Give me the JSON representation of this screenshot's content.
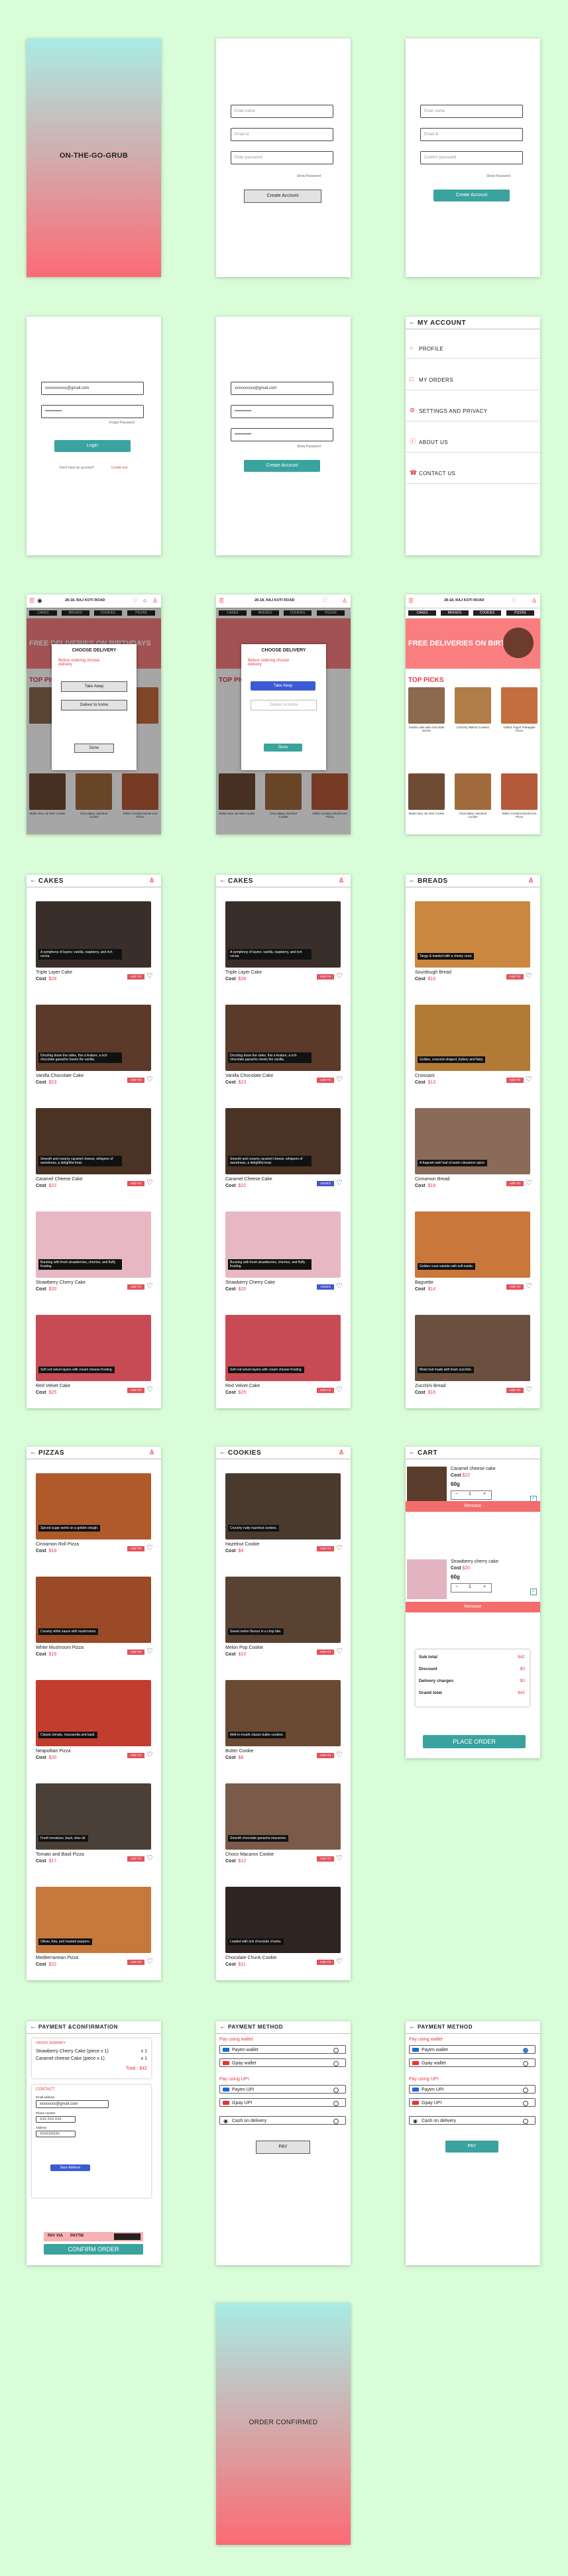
{
  "app": {
    "name": "ON-THE-GO-GRUB"
  },
  "signup": {
    "name": "Enter name",
    "email": "Email id",
    "password": "Enter password",
    "confirm": "Confirm password",
    "show": "Show Password",
    "button": "Create Account"
  },
  "login": {
    "email": "xxxxxxxxxxx@gmail.com",
    "password": "••••••••••••",
    "forgot": "Forgot Password",
    "button": "Login",
    "no_account": "Don't have an account?",
    "create": "Create one"
  },
  "filled_signup": {
    "email": "xxxxxxxxxx@gmail.com",
    "password": "••••••••••••",
    "confirm": "••••••••••••",
    "show": "Show Password",
    "button": "Create Account"
  },
  "account": {
    "title": "MY ACCOUNT",
    "items": [
      {
        "label": "PROFILE",
        "icon": "user-icon"
      },
      {
        "label": "MY ORDERS",
        "icon": "bag-icon"
      },
      {
        "label": "SETTINGS AND PRIVACY",
        "icon": "gear-icon"
      },
      {
        "label": "ABOUT US",
        "icon": "info-icon"
      },
      {
        "label": "CONTACT US",
        "icon": "phone-icon"
      }
    ]
  },
  "home": {
    "delivery_label": "DELIVER TO",
    "location": "28-18, RAJ KOTI ROAD",
    "categories": [
      "CAKES",
      "BREADS",
      "COOKIES",
      "PIZZAS"
    ],
    "banner": "FREE DELIVERIES ON BIRTHDAYS",
    "top_picks": "TOP PICKS",
    "picks": [
      "Vanilla cake with chocolate drizzle",
      "Crunchy Walnut Cookies",
      "Grilled Yogurt Pineapple Pizza",
      "Maker Box Jar Mini Cookie",
      "Chocolatey Hazelnut Cookie",
      "White Crestina Mushroom Pizza"
    ],
    "dialog": {
      "title": "CHOOSE DELIVERY",
      "question": "Before ordering choose delivery",
      "opt1": "Take Away",
      "opt2": "Deliver to home",
      "done": "Done"
    }
  },
  "cakes": {
    "title": "CAKES",
    "cost_label": "Cost",
    "items": [
      {
        "name": "Triple Layer Cake",
        "price": "$28",
        "caption": "A symphony of layers: vanilla, raspberry, and rich cocoa."
      },
      {
        "name": "Vanilla Chocolate Cake",
        "price": "$23",
        "caption": "Drizzling down the sides, this a feature, a rich chocolate ganache meets the vanilla."
      },
      {
        "name": "Caramel Cheese Cake",
        "price": "$22",
        "caption": "Smooth and creamy caramel cheese, whispers of sweetness, a delightful treat."
      },
      {
        "name": "Strawberry Cherry Cake",
        "price": "$20",
        "caption": "Bursting with fresh strawberries, cherries, and fluffy frosting."
      },
      {
        "name": "Red Velvet Cake",
        "price": "$25",
        "caption": "Soft red velvet layers with cream cheese frosting."
      }
    ],
    "add": "ADD TO CART",
    "added": "ADDED"
  },
  "breads": {
    "title": "BREADS",
    "cost_label": "Cost",
    "items": [
      {
        "name": "Sourdough Bread",
        "price": "$10",
        "caption": "Tangy & toasted with a chewy crust."
      },
      {
        "name": "Croissant",
        "price": "$13",
        "caption": "Golden, crescent-shaped, buttery and flaky."
      },
      {
        "name": "Cinnamon Bread",
        "price": "$18",
        "caption": "A fragrant swirl loaf of warm cinnamon spice."
      },
      {
        "name": "Baguette",
        "price": "$14",
        "caption": "Golden crust outside with soft inside."
      },
      {
        "name": "Zucchini Bread",
        "price": "$16",
        "caption": "Moist loaf made with fresh zucchini."
      }
    ],
    "add": "ADD TO CART"
  },
  "pizzas": {
    "title": "PIZZAS",
    "cost_label": "Cost",
    "items": [
      {
        "name": "Cinnamon Roll Pizza",
        "price": "$18",
        "caption": "Spiced sugar swirls on a golden dough."
      },
      {
        "name": "White Mushroom Pizza",
        "price": "$19",
        "caption": "Creamy white sauce with mushrooms."
      },
      {
        "name": "Neapolitan Pizza",
        "price": "$20",
        "caption": "Classic tomato, mozzarella and basil."
      },
      {
        "name": "Tomato and Basil Pizza",
        "price": "$17",
        "caption": "Fresh tomatoes, basil, olive oil."
      },
      {
        "name": "Mediterranean Pizza",
        "price": "$22",
        "caption": "Olives, feta, and roasted peppers."
      }
    ],
    "add": "ADD TO CART"
  },
  "cookies": {
    "title": "COOKIES",
    "cost_label": "Cost",
    "items": [
      {
        "name": "Hazelnut Cookie",
        "price": "$9",
        "caption": "Crunchy nutty hazelnut cookies."
      },
      {
        "name": "Melon Pop Cookie",
        "price": "$10",
        "caption": "Sweet melon flavour in a crisp bite."
      },
      {
        "name": "Butter Cookie",
        "price": "$8",
        "caption": "Melt-in-mouth classic butter cookies."
      },
      {
        "name": "Choco Macaron Cookie",
        "price": "$12",
        "caption": "Smooth chocolate ganache macarons."
      },
      {
        "name": "Chocolate Chunk Cookie",
        "price": "$11",
        "caption": "Loaded with rich chocolate chunks."
      }
    ],
    "add": "ADD TO CART"
  },
  "cart": {
    "title": "CART",
    "items": [
      {
        "name": "Caramel cheese cake",
        "cost": "$22",
        "weight": "60g",
        "qty": "1"
      },
      {
        "name": "Strawberry cherry cake",
        "cost": "$20",
        "weight": "60g",
        "qty": "1"
      }
    ],
    "cost_label": "Cost",
    "remove": "Remove",
    "summary": [
      {
        "label": "Sub total",
        "value": "$42"
      },
      {
        "label": "Discount",
        "value": "$0"
      },
      {
        "label": "Delivery charges",
        "value": "$0"
      },
      {
        "label": "Grand total",
        "value": "$42"
      }
    ],
    "place": "PLACE ORDER"
  },
  "confirmation": {
    "title": "PAYMENT &CONFIRMATION",
    "order_summary": "ORDER SUMMARY",
    "lines": [
      {
        "name": "Strawberry Cherry Cake (piece x 1)",
        "qty": "x 1"
      },
      {
        "name": "Caramel cheese Cake (piece x 1)",
        "qty": "x 1"
      }
    ],
    "total": "Total : $42",
    "contact": "CONTACT",
    "email_label": "Email address",
    "email": "xxxxxxxx@gmail.com",
    "phone_label": "Phone number",
    "phone": "XXX XXX XXX",
    "address_label": "Address",
    "address": "XXXXXXXXX",
    "save": "Save Address",
    "pay_label": "PAY VIA",
    "pay_value": "PAYTM",
    "confirm": "CONFIRM ORDER"
  },
  "payment": {
    "title": "PAYMENT METHOD",
    "wallet": "Pay using wallet",
    "upi": "Pay using UPI",
    "options": {
      "paytm_wallet": "Paytm wallet",
      "gpay_wallet": "Gpay wallet",
      "paytm_upi": "Paytm UPI",
      "gpay_upi": "Gpay UPI",
      "cod": "Cash on delivery"
    },
    "pay": "PAY"
  },
  "confirmed": {
    "text": "ORDER CONFIRMED"
  },
  "colors": {
    "accent": "#e53947",
    "teal": "#3aa39f",
    "banner": "#fa7e80",
    "bg": "#d8fdd8"
  }
}
